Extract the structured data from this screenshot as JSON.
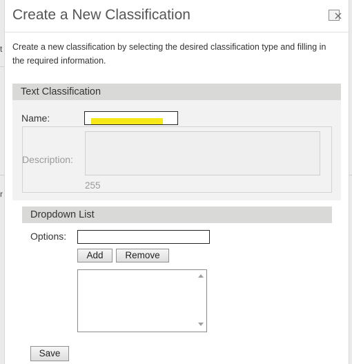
{
  "dialog": {
    "title": "Create a New Classification",
    "intro": "Create a new classification by selecting the desired classification type and filling in the required information."
  },
  "background": {
    "left_fragments": [
      "t",
      "r"
    ]
  },
  "text_classification": {
    "heading": "Text Classification",
    "name_label": "Name:",
    "name_value": "",
    "description_label": "Description:",
    "description_value": "",
    "char_count": "255"
  },
  "dropdown_list": {
    "heading": "Dropdown List",
    "options_label": "Options:",
    "options_value": "",
    "add_label": "Add",
    "remove_label": "Remove",
    "items": []
  },
  "actions": {
    "save_label": "Save"
  },
  "colors": {
    "highlight": "#f6e716",
    "section_header": "#d9d9d7"
  },
  "icons": {
    "close": "close-icon"
  }
}
